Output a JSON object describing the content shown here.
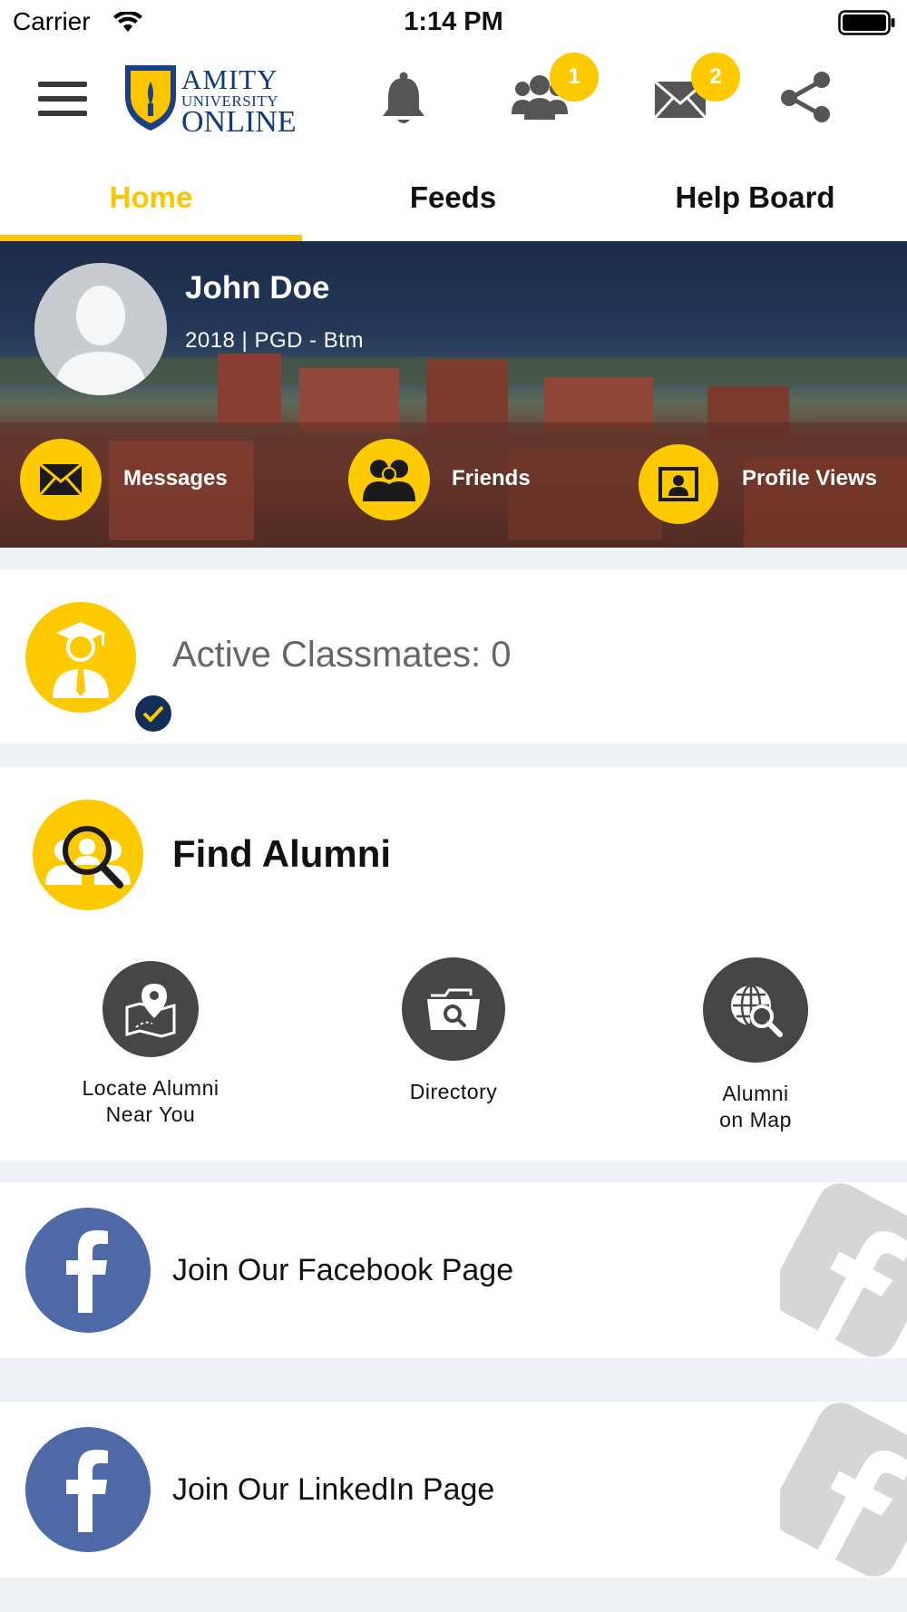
{
  "status_bar": {
    "carrier": "Carrier",
    "time": "1:14 PM"
  },
  "header": {
    "logo": {
      "line1": "AMITY",
      "line2": "UNIVERSITY",
      "line3": "ONLINE"
    },
    "icons": [
      "menu-icon",
      "bell-icon",
      "friends-icon",
      "mail-icon",
      "share-icon"
    ],
    "friends_badge": "1",
    "mail_badge": "2"
  },
  "tabs": [
    {
      "label": "Home",
      "active": true
    },
    {
      "label": "Feeds",
      "active": false
    },
    {
      "label": "Help Board",
      "active": false
    }
  ],
  "profile": {
    "name": "John Doe",
    "subtitle": "2018 | PGD - Btm",
    "actions": [
      {
        "label": "Messages",
        "icon": "envelope-icon"
      },
      {
        "label": "Friends",
        "icon": "friends-icon"
      },
      {
        "label": "Profile Views",
        "icon": "profile-card-icon"
      }
    ]
  },
  "classmates": {
    "text": "Active Classmates: 0"
  },
  "find_alumni": {
    "title": "Find Alumni",
    "items": [
      {
        "line1": "Locate Alumni",
        "line2": "Near You",
        "icon": "map-pin-icon"
      },
      {
        "line1": "Directory",
        "line2": "",
        "icon": "directory-search-icon"
      },
      {
        "line1": "Alumni",
        "line2": "on Map",
        "icon": "globe-search-icon"
      }
    ]
  },
  "social": {
    "facebook_label": "Join Our Facebook Page",
    "linkedin_label": "Join Our LinkedIn Page"
  },
  "colors": {
    "accent": "#fdc500",
    "facebook": "#4f68a6",
    "dark_icon": "#464646",
    "navy": "#132f57",
    "background": "#eef1f5"
  }
}
